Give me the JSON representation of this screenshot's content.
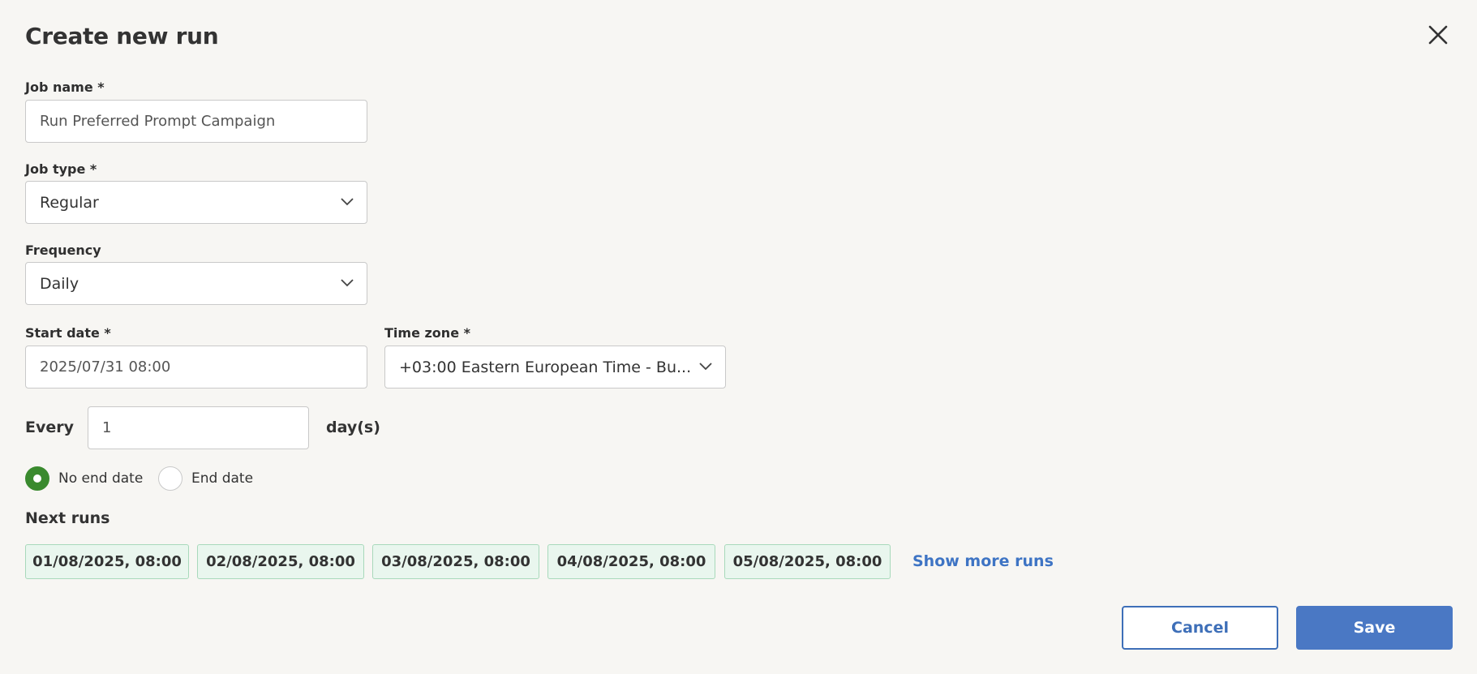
{
  "dialog": {
    "title": "Create new run",
    "close_icon": "close-icon"
  },
  "form": {
    "job_name": {
      "label": "Job name *",
      "value": "Run Preferred Prompt Campaign"
    },
    "job_type": {
      "label": "Job type *",
      "value": "Regular"
    },
    "frequency": {
      "label": "Frequency",
      "value": "Daily"
    },
    "start_date": {
      "label": "Start date *",
      "value": "2025/07/31 08:00"
    },
    "time_zone": {
      "label": "Time zone *",
      "value": "+03:00 Eastern European Time - Bu..."
    },
    "every": {
      "label": "Every",
      "value": "1",
      "unit": "day(s)"
    },
    "end_options": [
      {
        "label": "No end date",
        "checked": true
      },
      {
        "label": "End date",
        "checked": false
      }
    ]
  },
  "next_runs": {
    "title": "Next runs",
    "runs": [
      "01/08/2025, 08:00",
      "02/08/2025, 08:00",
      "03/08/2025, 08:00",
      "04/08/2025, 08:00",
      "05/08/2025, 08:00"
    ],
    "show_more": "Show more runs"
  },
  "actions": {
    "cancel": "Cancel",
    "save": "Save"
  },
  "colors": {
    "background": "#f7f6f3",
    "accent": "#4a78c4",
    "radio_selected": "#3a8a2e",
    "chip_bg": "#e9f6ee"
  }
}
